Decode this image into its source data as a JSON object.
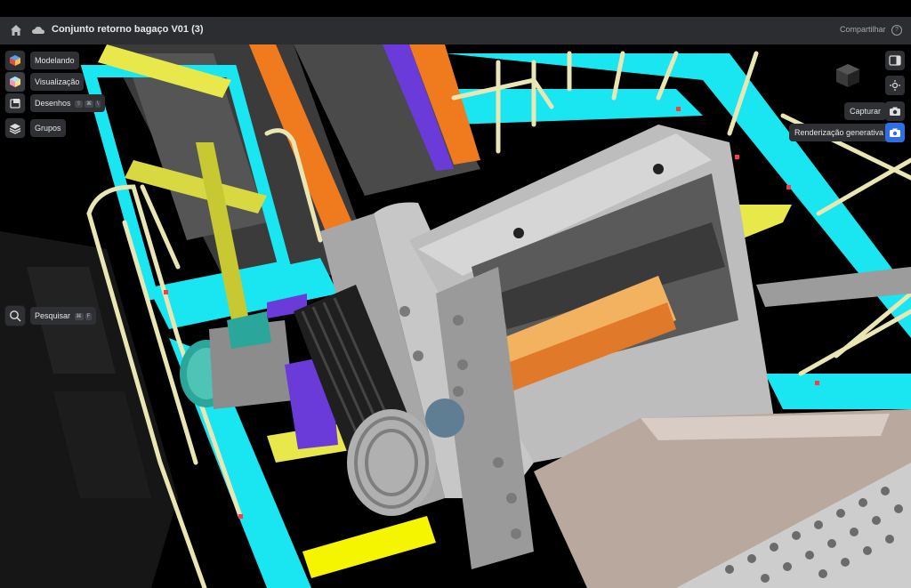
{
  "app": {
    "document_title": "Conjunto retorno bagaço V01 (3)",
    "share_label": "Compartilhar",
    "help_label": "?"
  },
  "left_toolbar": {
    "items": [
      {
        "label": "Modelando",
        "icon": "cube-icon"
      },
      {
        "label": "Visualização",
        "icon": "visualization-icon"
      },
      {
        "label": "Desenhos",
        "icon": "drawings-icon",
        "shortcut": [
          "⇧",
          "⌘",
          "\\"
        ]
      },
      {
        "label": "Grupos",
        "icon": "layers-icon"
      }
    ],
    "search": {
      "label": "Pesquisar",
      "icon": "search-icon",
      "shortcut": [
        "⌘",
        "F"
      ]
    }
  },
  "right_toolbar": {
    "items": [
      {
        "label": "",
        "icon": "panel-icon"
      },
      {
        "label": "",
        "icon": "orbit-icon"
      },
      {
        "label": "Capturar",
        "icon": "camera-icon"
      },
      {
        "label": "Renderização generativa",
        "icon": "generative-camera-icon"
      }
    ]
  },
  "colors": {
    "appbar": "#2b2d30",
    "accent_blue": "#2f6fe6",
    "structure_cyan": "#19e6f0",
    "structure_yellow": "#e8e84a",
    "railing_cream": "#e9e6b4",
    "conveyor_orange": "#f07a1e",
    "machine_gray": "#b8b8b8"
  }
}
